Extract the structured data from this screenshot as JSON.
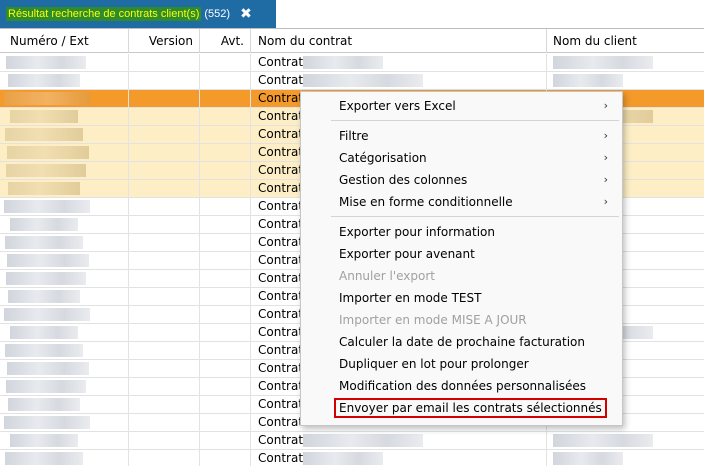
{
  "tab": {
    "title": "Résultat recherche de contrats client(s)",
    "count": "(552)",
    "close_glyph": "✖"
  },
  "columns": {
    "numero": "Numéro / Ext",
    "version": "Version",
    "avt": "Avt.",
    "contrat": "Nom du contrat",
    "client": "Nom du client"
  },
  "row_label": "Contrat",
  "rows": [
    {
      "state": "normal"
    },
    {
      "state": "normal"
    },
    {
      "state": "selected"
    },
    {
      "state": "highlight"
    },
    {
      "state": "highlight"
    },
    {
      "state": "highlight"
    },
    {
      "state": "highlight"
    },
    {
      "state": "highlight"
    },
    {
      "state": "normal"
    },
    {
      "state": "normal"
    },
    {
      "state": "normal"
    },
    {
      "state": "normal"
    },
    {
      "state": "normal"
    },
    {
      "state": "normal"
    },
    {
      "state": "normal"
    },
    {
      "state": "normal"
    },
    {
      "state": "normal"
    },
    {
      "state": "normal"
    },
    {
      "state": "normal"
    },
    {
      "state": "normal"
    },
    {
      "state": "normal"
    },
    {
      "state": "normal"
    },
    {
      "state": "normal"
    },
    {
      "state": "normal"
    }
  ],
  "menu": {
    "items": [
      {
        "label": "Exporter vers Excel",
        "submenu": true,
        "enabled": true
      },
      {
        "separator": true
      },
      {
        "label": "Filtre",
        "submenu": true,
        "enabled": true
      },
      {
        "label": "Catégorisation",
        "submenu": true,
        "enabled": true
      },
      {
        "label": "Gestion des colonnes",
        "submenu": true,
        "enabled": true
      },
      {
        "label": "Mise en forme conditionnelle",
        "submenu": true,
        "enabled": true
      },
      {
        "separator": true
      },
      {
        "label": "Exporter pour information",
        "enabled": true
      },
      {
        "label": "Exporter pour avenant",
        "enabled": true
      },
      {
        "label": "Annuler l'export",
        "enabled": false
      },
      {
        "label": "Importer en mode TEST",
        "enabled": true
      },
      {
        "label": "Importer en mode MISE A JOUR",
        "enabled": false
      },
      {
        "label": "Calculer la date de prochaine facturation",
        "enabled": true
      },
      {
        "label": "Dupliquer en lot pour prolonger",
        "enabled": true
      },
      {
        "label": "Modification des données personnalisées",
        "enabled": true
      },
      {
        "label": "Envoyer par email les contrats sélectionnés",
        "enabled": true,
        "highlighted_box": true
      }
    ],
    "submenu_arrow": "›"
  },
  "colors": {
    "tab_bg": "#1f6ba3",
    "tab_label_bg": "#2e8b2e",
    "tab_label_fg": "#ffff00",
    "selected_row": "#f39a2a",
    "highlight_row": "#fdeec5",
    "annotation_box": "#d40000"
  }
}
